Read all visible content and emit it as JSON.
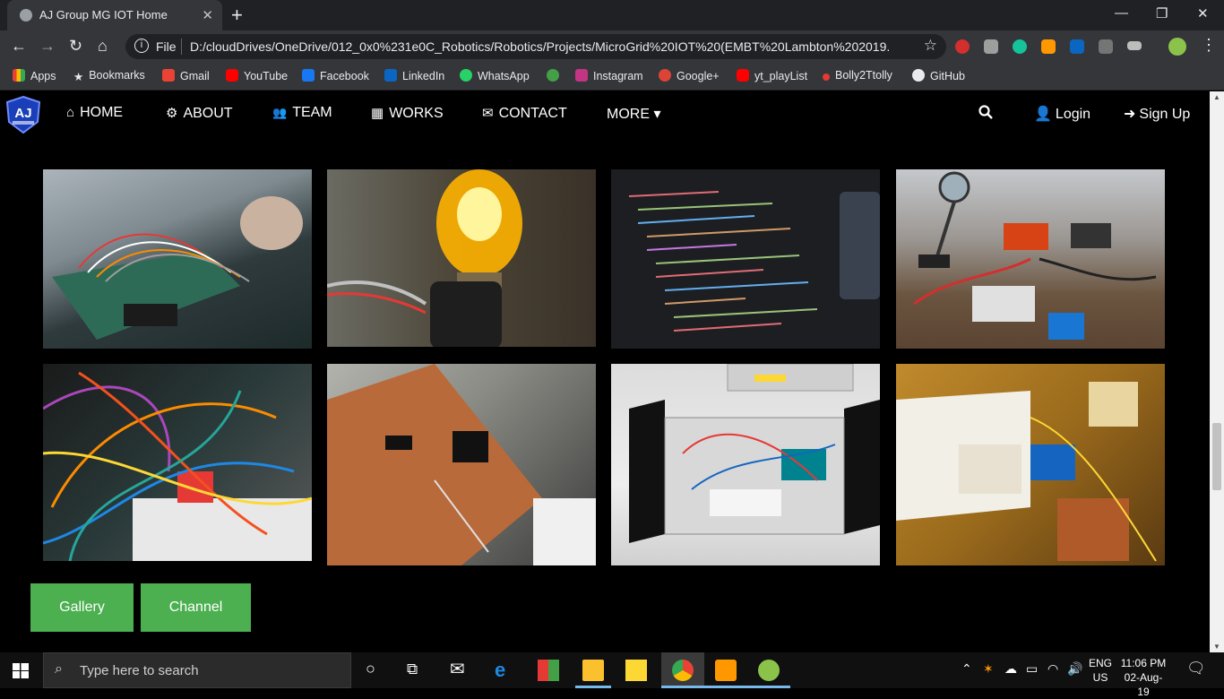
{
  "browser": {
    "tab_title": "AJ Group MG IOT Home",
    "new_tab_symbol": "+",
    "close_symbol": "✕",
    "minimize_symbol": "—",
    "restore_symbol": "❐",
    "window_close_symbol": "✕",
    "file_label": "File",
    "url": "D:/cloudDrives/OneDrive/012_0x0%231e0C_Robotics/Robotics/Projects/MicroGrid%20IOT%20(EMBT%20Lambton%202019..."
  },
  "bookmarks": [
    {
      "label": "Apps",
      "color": "#e94235"
    },
    {
      "label": "Bookmarks",
      "color": "#e8eaed"
    },
    {
      "label": "Gmail",
      "color": "#ea4335"
    },
    {
      "label": "YouTube",
      "color": "#ff0000"
    },
    {
      "label": "Facebook",
      "color": "#1877f2"
    },
    {
      "label": "LinkedIn",
      "color": "#0a66c2"
    },
    {
      "label": "WhatsApp",
      "color": "#25d366"
    },
    {
      "label": "",
      "color": "#43a047"
    },
    {
      "label": "Instagram",
      "color": "#c13584"
    },
    {
      "label": "Google+",
      "color": "#db4437"
    },
    {
      "label": "yt_playList",
      "color": "#ff0000"
    },
    {
      "label": "Bolly2Ttolly",
      "color": "#e53935"
    },
    {
      "label": "GitHub",
      "color": "#e8eaed"
    }
  ],
  "site": {
    "logo_text": "AJ",
    "nav": [
      {
        "label": "HOME",
        "icon": "home-icon",
        "glyph": "⌂"
      },
      {
        "label": "ABOUT",
        "icon": "gear-icon",
        "glyph": "⚙"
      },
      {
        "label": "TEAM",
        "icon": "users-icon",
        "glyph": "👥"
      },
      {
        "label": "WORKS",
        "icon": "grid-icon",
        "glyph": "▦"
      },
      {
        "label": "CONTACT",
        "icon": "envelope-icon",
        "glyph": "✉"
      },
      {
        "label": "MORE ▾",
        "icon": "",
        "glyph": ""
      }
    ],
    "login_label": "Login",
    "signup_label": "Sign Up",
    "gallery_button": "Gallery",
    "channel_button": "Channel"
  },
  "taskbar": {
    "search_placeholder": "Type here to search",
    "language": "ENG",
    "region": "US",
    "time": "11:06 PM",
    "date": "02-Aug-19"
  }
}
